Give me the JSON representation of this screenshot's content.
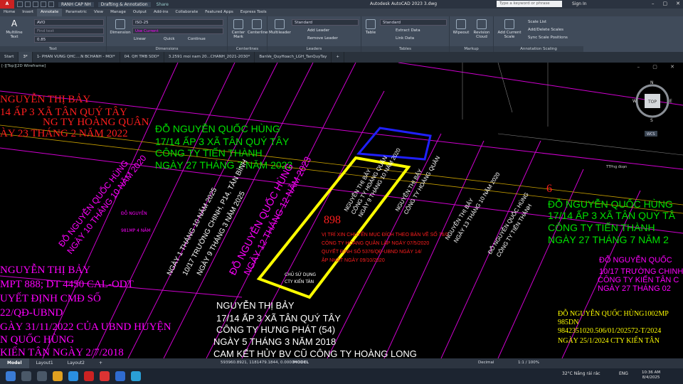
{
  "titlebar": {
    "logo": "A CAD",
    "workspace": "RANH CAP NH",
    "workspace2": "Drafting & Annotation",
    "share": "Share",
    "title": "Autodesk AutoCAD 2023   3.dwg",
    "search_placeholder": "Type a keyword or phrase",
    "signin": "Sign In"
  },
  "ribbon_tabs": [
    "Home",
    "Insert",
    "Annotate",
    "Parametric",
    "View",
    "Manage",
    "Output",
    "Add-ins",
    "Collaborate",
    "Featured Apps",
    "Express Tools"
  ],
  "ribbon_active_tab": "Annotate",
  "ribbon": {
    "text_panel": {
      "title": "Text",
      "multiline": "Multiline",
      "multiline2": "Text",
      "style": "AVO",
      "find": "Find text",
      "height": "0.85"
    },
    "dimensions_panel": {
      "title": "Dimensions",
      "dimension": "Dimension",
      "style": "ISO-25",
      "layer": "Use Current",
      "linear": "Linear",
      "quick": "Quick",
      "continue": "Continue"
    },
    "centerlines_panel": {
      "title": "Centerlines",
      "center_mark": "Center Mark",
      "centerline": "Centerline"
    },
    "leaders_panel": {
      "title": "Leaders",
      "multileader": "Multileader",
      "style": "Standard",
      "add": "Add Leader",
      "remove": "Remove Leader"
    },
    "tables_panel": {
      "title": "Tables",
      "table": "Table",
      "style": "Standard",
      "extract": "Extract Data",
      "link": "Link Data"
    },
    "markup_panel": {
      "title": "Markup",
      "wipeout": "Wipeout",
      "revision": "Revision Cloud"
    },
    "scaling_panel": {
      "title": "Annotation Scaling",
      "add": "Add Current Scale",
      "scale_list": "Scale List",
      "add_delete": "Add/Delete Scales",
      "sync": "Sync Scale Positions"
    }
  },
  "doc_tabs": [
    "Start",
    "3*",
    "1- PHAN VUNG QHC....N BCHANH - MOI*",
    "04. QH TMB SDD*",
    "3.2591 moi nam 20...CHANH_2021-2030*",
    "BanVe_QuyHoach_LGH_TanQuyTay",
    "+"
  ],
  "viewport_label": "[-][Top][2D Wireframe]",
  "viewport_controls": "– ▢ ✕",
  "viewcube": {
    "top": "TOP",
    "n": "N",
    "s": "S",
    "e": "E",
    "w": "W",
    "wcs": "WCS"
  },
  "drawing_texts": {
    "red_tl_1": "NGUYỄN THỊ BẢY",
    "red_tl_2": "14 ẤP 3 XÃ TÂN QUÝ TÂY",
    "red_tl_3": "NG TY HOÀNG QUÂN",
    "red_tl_4": "ÀY 23 THÁNG 2 NĂM 2022",
    "green_top_1": "ĐỖ NGUYỄN QUỐC HÙNG",
    "green_top_2": "17/14 ẤP 3 XÃ TÂN QUÝ TÂY",
    "green_top_3": "CÔNG TY TIẾN THÀNH",
    "green_top_4": "NGÀY 27 THÁNG 7 NĂM 2023",
    "green_right_1": "ĐỖ NGUYỄN QUỐC HÙNG",
    "green_right_2": "17/14 ẤP 3 XÃ TÂN QUÝ TÂ",
    "green_right_3": "CÔNG TY TIẾN THÀNH",
    "green_right_4": "NGÀY 27 THÁNG 7 NĂM 2",
    "mag_right_1": "ĐỖ NGUYỄN QUỐC",
    "mag_right_2": "10/17 TRƯỜNG CHINH",
    "mag_right_3": "CÔNG TY KIẾN TÂN C",
    "mag_right_4": "NGÀY 27 THÁNG 02",
    "white_bottom_1": "NGUYỄN THỊ BẢY",
    "white_bottom_2": "17/14 ẤP 3 XÃ TÂN QUÝ TÂY",
    "white_bottom_3": "CÔNG TY HƯNG PHÁT (54)",
    "white_bottom_4": "NGÀY 5 THÁNG 3 NĂM 2018",
    "white_bottom_5": "CAM KẾT HỦY BV CŨ CÔNG TY HOÀNG LONG",
    "yellow_right_1": "ĐỖ NGUYỄN QUỐC HÙNG1002MP",
    "yellow_right_2": "985DN",
    "yellow_right_3": "9842351020.506/01/202572-T/2024",
    "yellow_right_4": "NGÀY 25/1/2024 CTY KIẾN TÂN",
    "mag_left_1": "NGUYỄN THỊ BẢY",
    "mag_left_2": "MPT 888; DT 4450 CAL-ODT",
    "mag_left_3": "UYẾT ĐỊNH CMĐ SỐ",
    "mag_left_4": "22/QĐ-UBND",
    "mag_left_5": "GÀY 31/11/2022 CỦA UBND HUYỆN",
    "mag_left_6": "N QUỐC HÙNG",
    "mag_left_7": "KIẾN TÂN NGÀY 2/7/2018",
    "parcel_no": "898",
    "parcel_note_1": "VỊ TRÍ XIN CHUYỂN MỤC ĐÍCH THEO BẢN VẼ SỐ 76/0",
    "parcel_note_2": "CÔNG TY HOÀNG QUÂN LẬP NGÀY 07/5/2020",
    "parcel_note_3": "QUYẾT ĐỊNH SỐ 5376/QĐ-UBND NGÀY 14/",
    "parcel_note_4": "ẬP NHẬT NGÀY 09/10/2020",
    "rot_1": "ĐỖ NGUYỄN QUỐC HÙNG",
    "rot_2": "NGÀY 10 THÁNG 10 NĂM 2020",
    "rot_3": "NGÀY 12 THÁNG 12 NĂM 2023",
    "rot_4": "NGUYỄN THỊ BẢY",
    "rot_5": "CÔNG TY HOÀNG QUÂN",
    "rot_6": "NGÀY 9 THÁNG 10 NĂM 2020",
    "rot_7": "CÔNG TY TIẾN THÀNH",
    "rot_8": "NGÀY 13 THÁNG 10 NĂM 2020",
    "rot_9": "NGÀY 1 THÁNG 10 NĂM 2025",
    "rot_10": "10/17 TRƯỜNG CHINH, P14, TÂN BÌNH",
    "rot_11": "NGÀY 9 THÁNG 3 NĂM 2025",
    "small_1": "ĐỖ NGUYỄN",
    "small_2": "981MP 4 NĂM",
    "small_3": "CHỦ SỬ DỤNG",
    "small_4": "CTY KIẾN TÂN",
    "parcel_6": "6",
    "ttpng": "TTPng  đoạn"
  },
  "statusbar": {
    "tabs": [
      "Model",
      "Layout1",
      "Layout2",
      "+"
    ],
    "coords": "593960.8921, 1181479.1844, 0.0000",
    "model": "MODEL",
    "units": "Decimal",
    "scale": "1:1 / 100%"
  },
  "taskbar": {
    "weather": "32°C  Nắng rải rác",
    "lang": "ENG",
    "time": "10:36 AM",
    "date": "8/4/2025"
  },
  "colors": {
    "bg": "#000000",
    "red": "#ff1e1e",
    "green": "#00e000",
    "magenta": "#ff00ff",
    "yellow": "#ffff00",
    "blue": "#2020ff",
    "white": "#ffffff"
  }
}
